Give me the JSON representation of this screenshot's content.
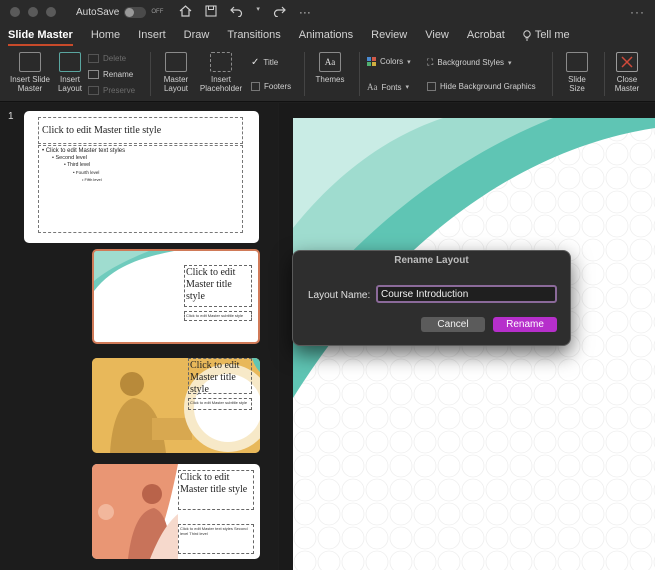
{
  "titlebar": {
    "autosave_label": "AutoSave",
    "autosave_state": "OFF",
    "icons": [
      "home-icon",
      "save-icon",
      "undo-icon",
      "redo-icon",
      "more-icon"
    ]
  },
  "tabs": [
    {
      "label": "Slide Master",
      "active": true
    },
    {
      "label": "Home"
    },
    {
      "label": "Insert"
    },
    {
      "label": "Draw"
    },
    {
      "label": "Transitions"
    },
    {
      "label": "Animations"
    },
    {
      "label": "Review"
    },
    {
      "label": "View"
    },
    {
      "label": "Acrobat"
    },
    {
      "label": "Tell me"
    }
  ],
  "ribbon": {
    "insert_slide_master": "Insert Slide Master",
    "insert_layout": "Insert Layout",
    "delete": "Delete",
    "rename": "Rename",
    "preserve": "Preserve",
    "master_layout": "Master Layout",
    "insert_placeholder": "Insert Placeholder",
    "title": "Title",
    "footers": "Footers",
    "themes": "Themes",
    "colors": "Colors",
    "fonts": "Fonts",
    "background_styles": "Background Styles",
    "hide_background_graphics": "Hide Background Graphics",
    "slide_size": "Slide Size",
    "close_master": "Close Master"
  },
  "left_panel": {
    "slide_number": "1",
    "master": {
      "title": "Click to edit Master title style",
      "levels": [
        "Click to edit Master text styles",
        "Second level",
        "Third level",
        "Fourth level",
        "Fifth level"
      ]
    },
    "layouts": [
      {
        "title": "Click to edit Master title style",
        "subtitle": "Click to edit Master subtitle style"
      },
      {
        "title": "Click to edit Master title style",
        "subtitle": "Click to edit Master subtitle style"
      },
      {
        "title": "Click to edit Master title style",
        "subtitle": "Click to edit Master text styles Second level Third level"
      }
    ]
  },
  "dialog": {
    "title": "Rename Layout",
    "label": "Layout Name:",
    "value": "Course Introduction",
    "cancel": "Cancel",
    "rename": "Rename"
  },
  "colors": {
    "accent_tab": "#c84a2a",
    "rename_button": "#b62fcb",
    "teal": "#5fc5b4",
    "selected_thumb_border": "#d07a58"
  }
}
